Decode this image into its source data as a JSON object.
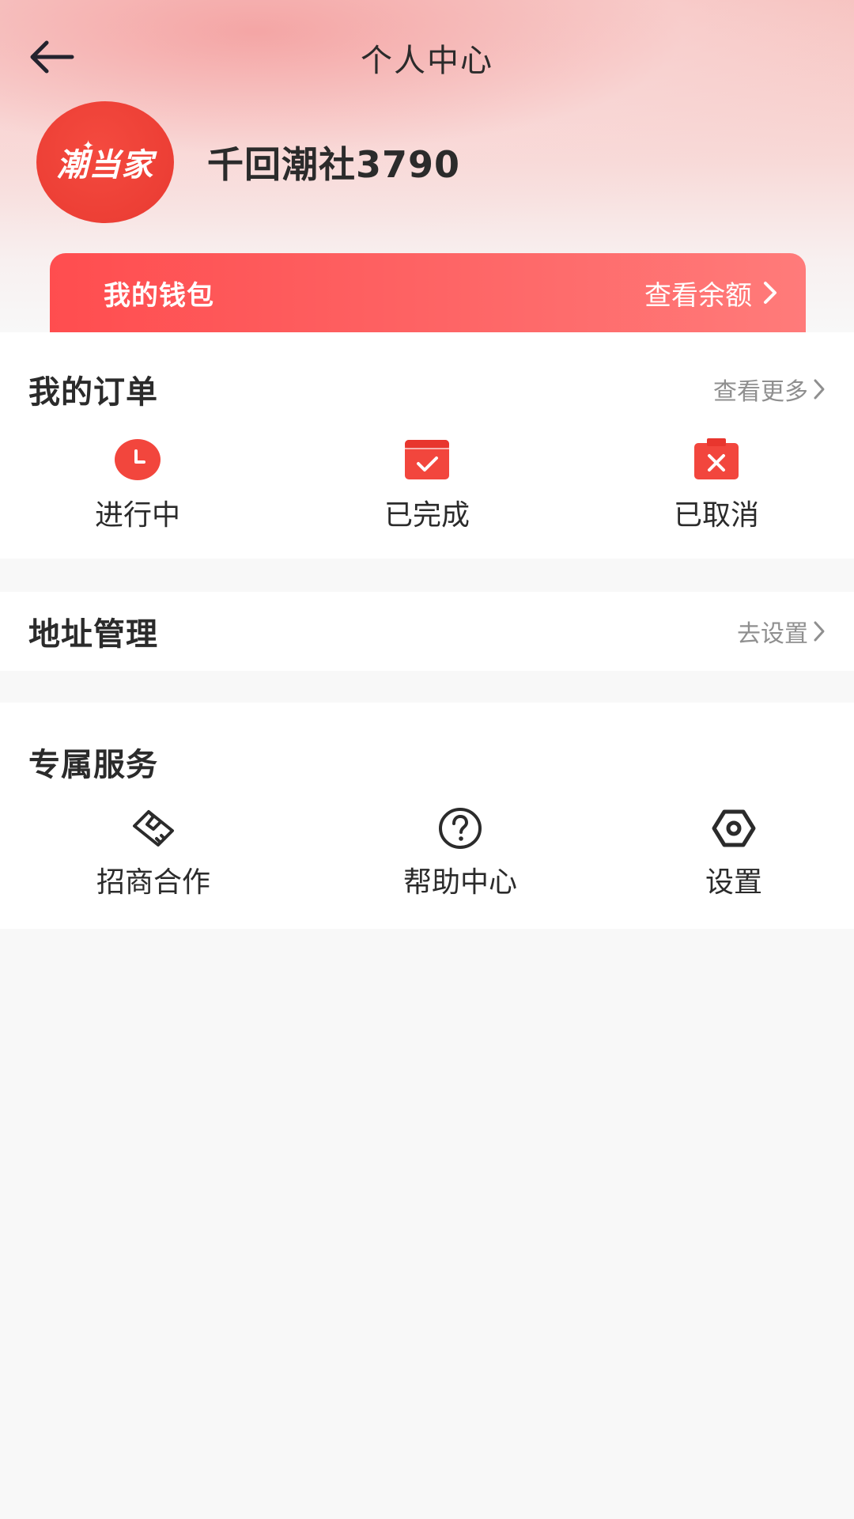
{
  "nav": {
    "title": "个人中心",
    "back_icon": "arrow-left-icon"
  },
  "profile": {
    "avatar_logo_text": "潮当家",
    "username": "千回潮社3790"
  },
  "wallet": {
    "title": "我的钱包",
    "link_label": "查看余额",
    "colors": {
      "start": "#ff4d4f",
      "end": "#ff7b7a"
    }
  },
  "orders": {
    "title": "我的订单",
    "more_label": "查看更多",
    "items": [
      {
        "label": "进行中",
        "icon": "clock-icon"
      },
      {
        "label": "已完成",
        "icon": "calendar-check-icon"
      },
      {
        "label": "已取消",
        "icon": "calendar-cancel-icon"
      }
    ]
  },
  "address": {
    "title": "地址管理",
    "action_label": "去设置"
  },
  "services": {
    "title": "专属服务",
    "items": [
      {
        "label": "招商合作",
        "icon": "handshake-icon"
      },
      {
        "label": "帮助中心",
        "icon": "help-circle-icon"
      },
      {
        "label": "设置",
        "icon": "settings-hexagon-icon"
      }
    ]
  },
  "colors": {
    "accent": "#f2463d",
    "text": "#2b2b2b",
    "muted": "#8f8f8f",
    "page_bg": "#f8f8f8"
  }
}
